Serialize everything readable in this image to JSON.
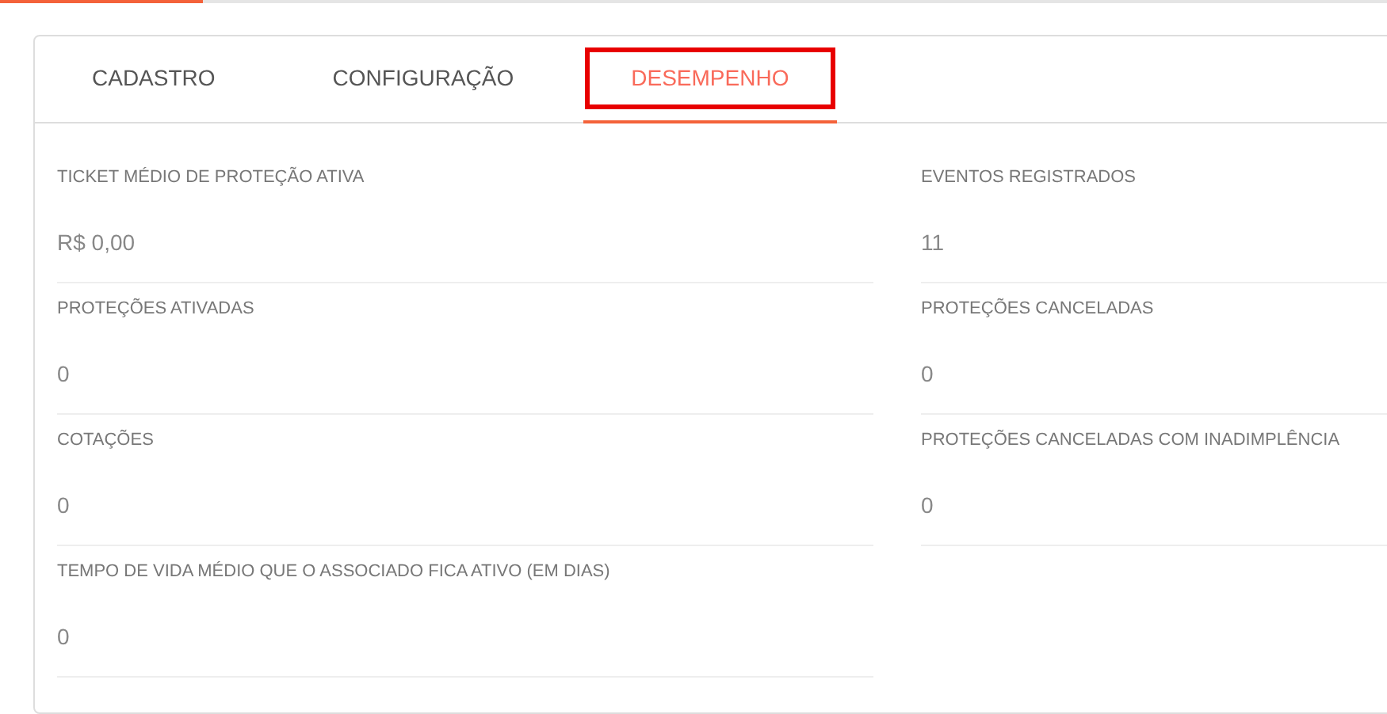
{
  "tabs": [
    {
      "label": "CADASTRO",
      "selected": false,
      "highlighted": false
    },
    {
      "label": "CONFIGURAÇÃO",
      "selected": false,
      "highlighted": false
    },
    {
      "label": "DESEMPENHO",
      "selected": true,
      "highlighted": true
    }
  ],
  "metrics": [
    {
      "label": "TICKET MÉDIO DE PROTEÇÃO ATIVA",
      "value": "R$ 0,00"
    },
    {
      "label": "EVENTOS REGISTRADOS",
      "value": "11"
    },
    {
      "label": "PROTEÇÕES ATIVADAS",
      "value": "0"
    },
    {
      "label": "PROTEÇÕES CANCELADAS",
      "value": "0"
    },
    {
      "label": "COTAÇÕES",
      "value": "0"
    },
    {
      "label": "PROTEÇÕES CANCELADAS COM INADIMPLÊNCIA",
      "value": "0"
    },
    {
      "label": "TEMPO DE VIDA MÉDIO QUE O ASSOCIADO FICA ATIVO (EM DIAS)",
      "value": "0"
    }
  ]
}
